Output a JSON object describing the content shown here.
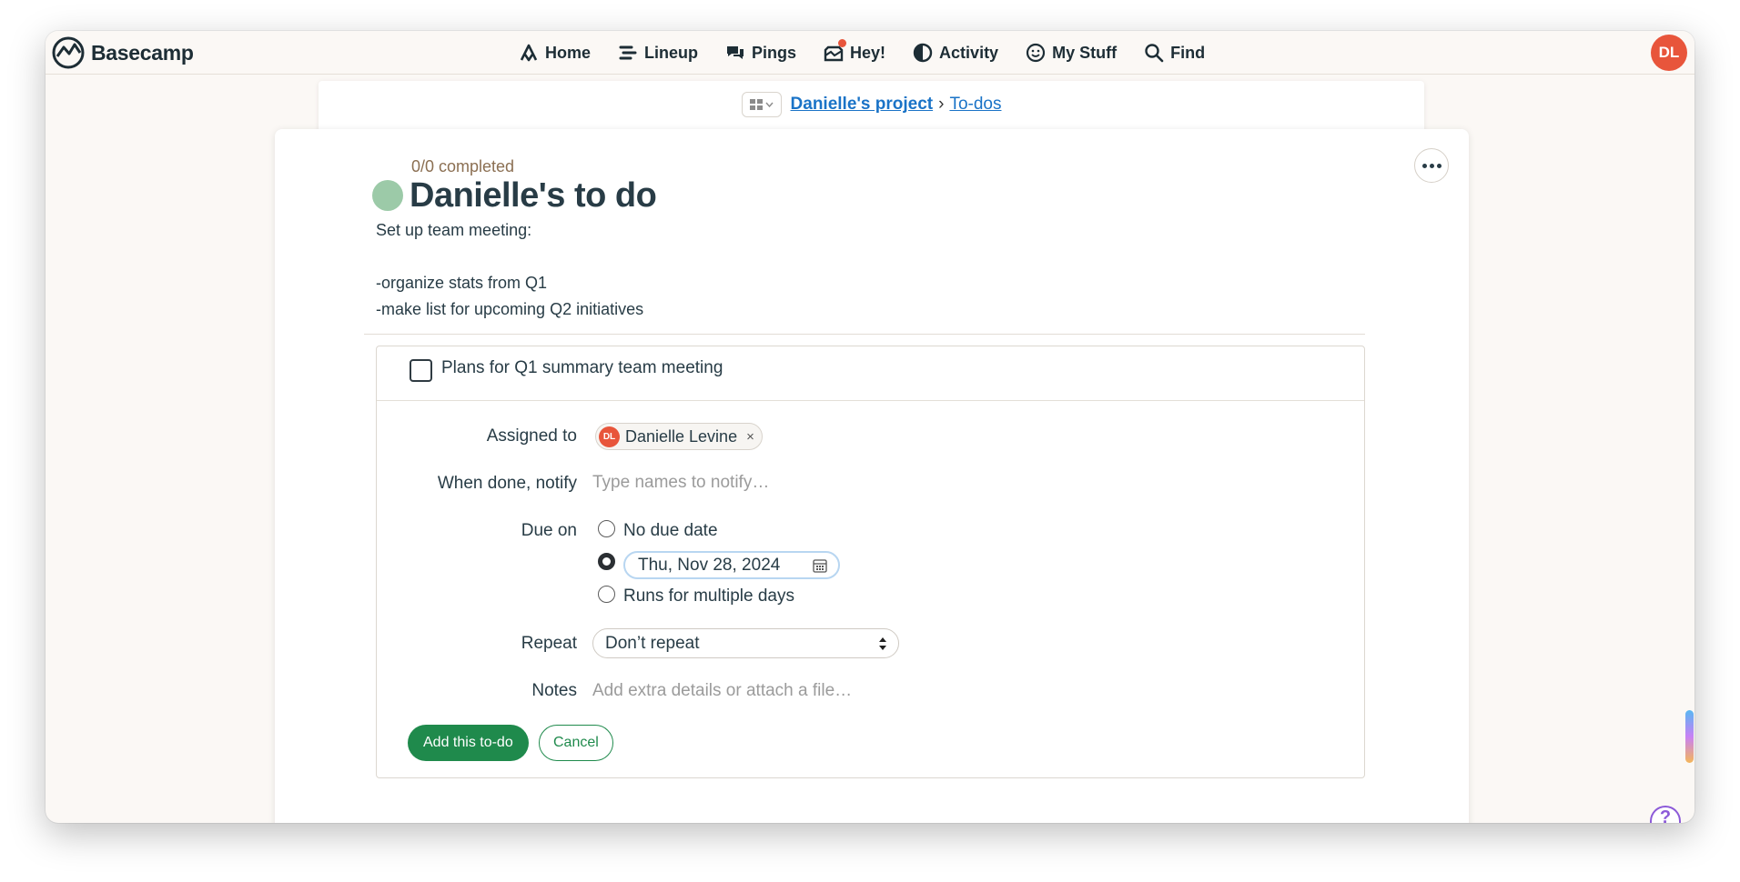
{
  "app": {
    "name": "Basecamp",
    "user_initials": "DL"
  },
  "nav": {
    "items": [
      {
        "label": "Home",
        "icon": "home-icon"
      },
      {
        "label": "Lineup",
        "icon": "lineup-icon"
      },
      {
        "label": "Pings",
        "icon": "pings-icon"
      },
      {
        "label": "Hey!",
        "icon": "hey-icon"
      },
      {
        "label": "Activity",
        "icon": "activity-icon"
      },
      {
        "label": "My Stuff",
        "icon": "my-stuff-icon"
      },
      {
        "label": "Find",
        "icon": "search-icon"
      }
    ],
    "notification_color": "#e8553b"
  },
  "breadcrumb": {
    "project": "Danielle's project",
    "separator": "›",
    "section": "To-dos"
  },
  "todolist": {
    "completed": "0/0 completed",
    "title": "Danielle's to do",
    "dot_color": "#9ccaa8",
    "description": [
      "Set up team meeting:",
      "",
      "-organize stats from Q1",
      "-make list for upcoming Q2 initiatives"
    ]
  },
  "form": {
    "todo_title": "Plans for Q1 summary team meeting",
    "assigned_label": "Assigned to",
    "assignee": {
      "initials": "DL",
      "name": "Danielle Levine",
      "remove": "×"
    },
    "notify_label": "When done, notify",
    "notify_placeholder": "Type names to notify…",
    "due_label": "Due on",
    "due_options": [
      {
        "label": "No due date",
        "selected": false
      },
      {
        "label": "Thu, Nov 28, 2024",
        "selected": true
      },
      {
        "label": "Runs for multiple days",
        "selected": false
      }
    ],
    "repeat_label": "Repeat",
    "repeat_value": "Don’t repeat",
    "notes_label": "Notes",
    "notes_placeholder": "Add extra details or attach a file…",
    "submit_label": "Add this to-do",
    "cancel_label": "Cancel",
    "accent": "#1f8a4c"
  },
  "help": {
    "label": "?"
  }
}
